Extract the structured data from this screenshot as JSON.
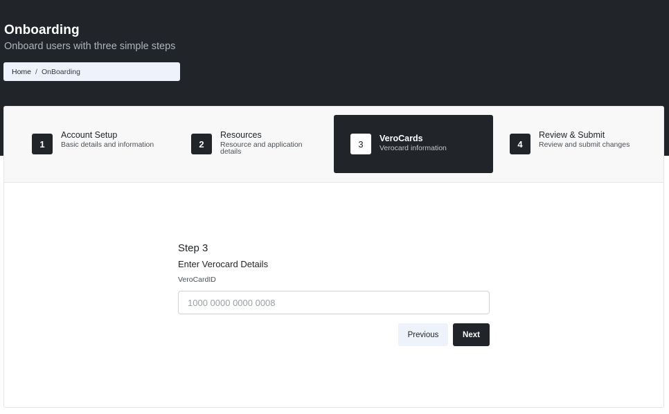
{
  "header": {
    "title": "Onboarding",
    "subtitle": "Onboard users with three simple steps"
  },
  "breadcrumb": {
    "home": "Home",
    "separator": "/",
    "current": "OnBoarding"
  },
  "stepper": {
    "active_index": 3,
    "steps": [
      {
        "number": "1",
        "title": "Account Setup",
        "description": "Basic details and information"
      },
      {
        "number": "2",
        "title": "Resources",
        "description": "Resource and application details"
      },
      {
        "number": "3",
        "title": "VeroCards",
        "description": "Verocard information"
      },
      {
        "number": "4",
        "title": "Review & Submit",
        "description": "Review and submit changes"
      }
    ]
  },
  "form": {
    "step_label": "Step 3",
    "heading": "Enter Verocard Details",
    "field_label": "VeroCardID",
    "field_value": "",
    "field_placeholder": "1000 0000 0000 0008",
    "previous_label": "Previous",
    "next_label": "Next"
  },
  "colors": {
    "dark": "#212429",
    "light_button": "#eef2fb",
    "stepper_bg": "#f8f8f8"
  }
}
